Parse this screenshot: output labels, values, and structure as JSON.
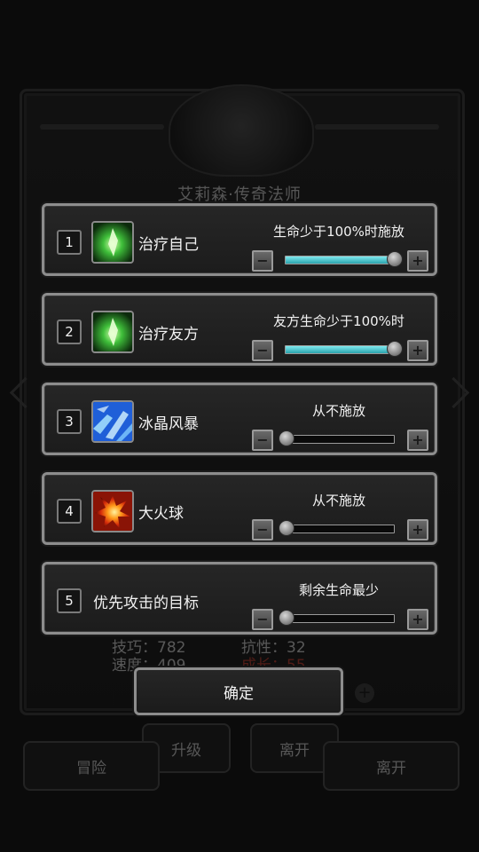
{
  "background": {
    "hero_title": "艾莉森·传奇法师",
    "stats": [
      {
        "text": "技巧：782"
      },
      {
        "text": "抗性：32"
      },
      {
        "text": "速度：409"
      },
      {
        "text": "成长：55"
      }
    ],
    "buttons": {
      "adventure": "冒险",
      "upgrade": "升级",
      "leave_inner": "离开",
      "leave_outer": "离开"
    }
  },
  "skills": [
    {
      "index": "1",
      "name": "治疗自己",
      "icon": "green-crystal-icon",
      "condition": "生命少于100%时施放",
      "level": 1.0
    },
    {
      "index": "2",
      "name": "治疗友方",
      "icon": "green-crystal-icon",
      "condition": "友方生命少于100%时",
      "level": 1.0
    },
    {
      "index": "3",
      "name": "冰晶风暴",
      "icon": "ice-storm-icon",
      "condition": "从不施放",
      "level": 0.0
    },
    {
      "index": "4",
      "name": "大火球",
      "icon": "fireball-icon",
      "condition": "从不施放",
      "level": 0.0
    },
    {
      "index": "5",
      "name": "优先攻击的目标",
      "icon": "",
      "condition": "剩余生命最少",
      "level": 0.0
    }
  ],
  "confirm_label": "确定",
  "colors": {
    "slider_fill": "#4fd2d9",
    "panel_border": "#8d8d8d",
    "stat_highlight": "#c0392b"
  }
}
